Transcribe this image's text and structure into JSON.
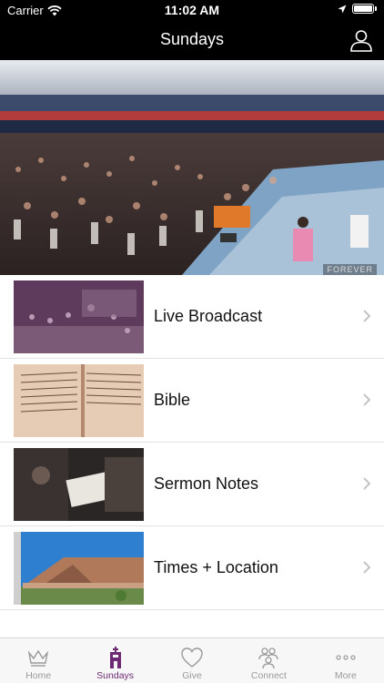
{
  "status_bar": {
    "carrier": "Carrier",
    "time": "11:02 AM"
  },
  "nav": {
    "title": "Sundays"
  },
  "hero": {
    "caption": "FOREVER"
  },
  "list": [
    {
      "label": "Live Broadcast"
    },
    {
      "label": "Bible"
    },
    {
      "label": "Sermon Notes"
    },
    {
      "label": "Times + Location"
    }
  ],
  "tabs": [
    {
      "label": "Home",
      "icon": "crown-icon"
    },
    {
      "label": "Sundays",
      "icon": "church-icon"
    },
    {
      "label": "Give",
      "icon": "heart-icon"
    },
    {
      "label": "Connect",
      "icon": "people-icon"
    },
    {
      "label": "More",
      "icon": "more-icon"
    }
  ],
  "colors": {
    "active_tab": "#6e2a73",
    "inactive_tab": "#9a9a9a",
    "bar": "#000000"
  }
}
